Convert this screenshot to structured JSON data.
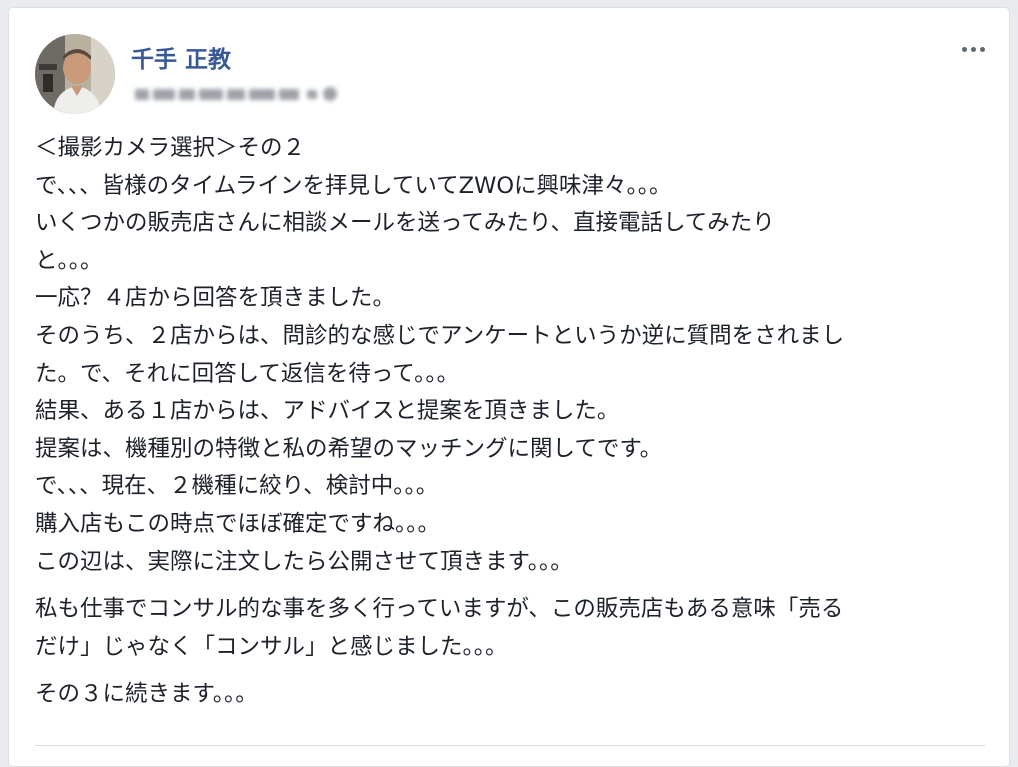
{
  "post": {
    "author": "千手 正教",
    "paragraphs": [
      "＜撮影カメラ選択＞その２\nで、、、皆様のタイムラインを拝見していてZWOに興味津々。。。\nいくつかの販売店さんに相談メールを送ってみたり、直接電話してみたり\nと。。。\n一応？４店から回答を頂きました。\nそのうち、２店からは、問診的な感じでアンケートというか逆に質問をされまし\nた。で、それに回答して返信を待って。。。\n結果、ある１店からは、アドバイスと提案を頂きました。\n提案は、機種別の特徴と私の希望のマッチングに関してです。\nで、、、現在、２機種に絞り、検討中。。。\n購入店もこの時点でほぼ確定ですね。。。\nこの辺は、実際に注文したら公開させて頂きます。。。",
      "私も仕事でコンサル的な事を多く行っていますが、この販売店もある意味「売る\nだけ」じゃなく「コンサル」と感じました。。。",
      "その３に続きます。。。"
    ]
  },
  "icons": {
    "avatar": "profile-photo",
    "more": "more-options-icon"
  },
  "colors": {
    "author_link": "#385898",
    "text": "#1d2129",
    "background": "#e9ebee"
  }
}
